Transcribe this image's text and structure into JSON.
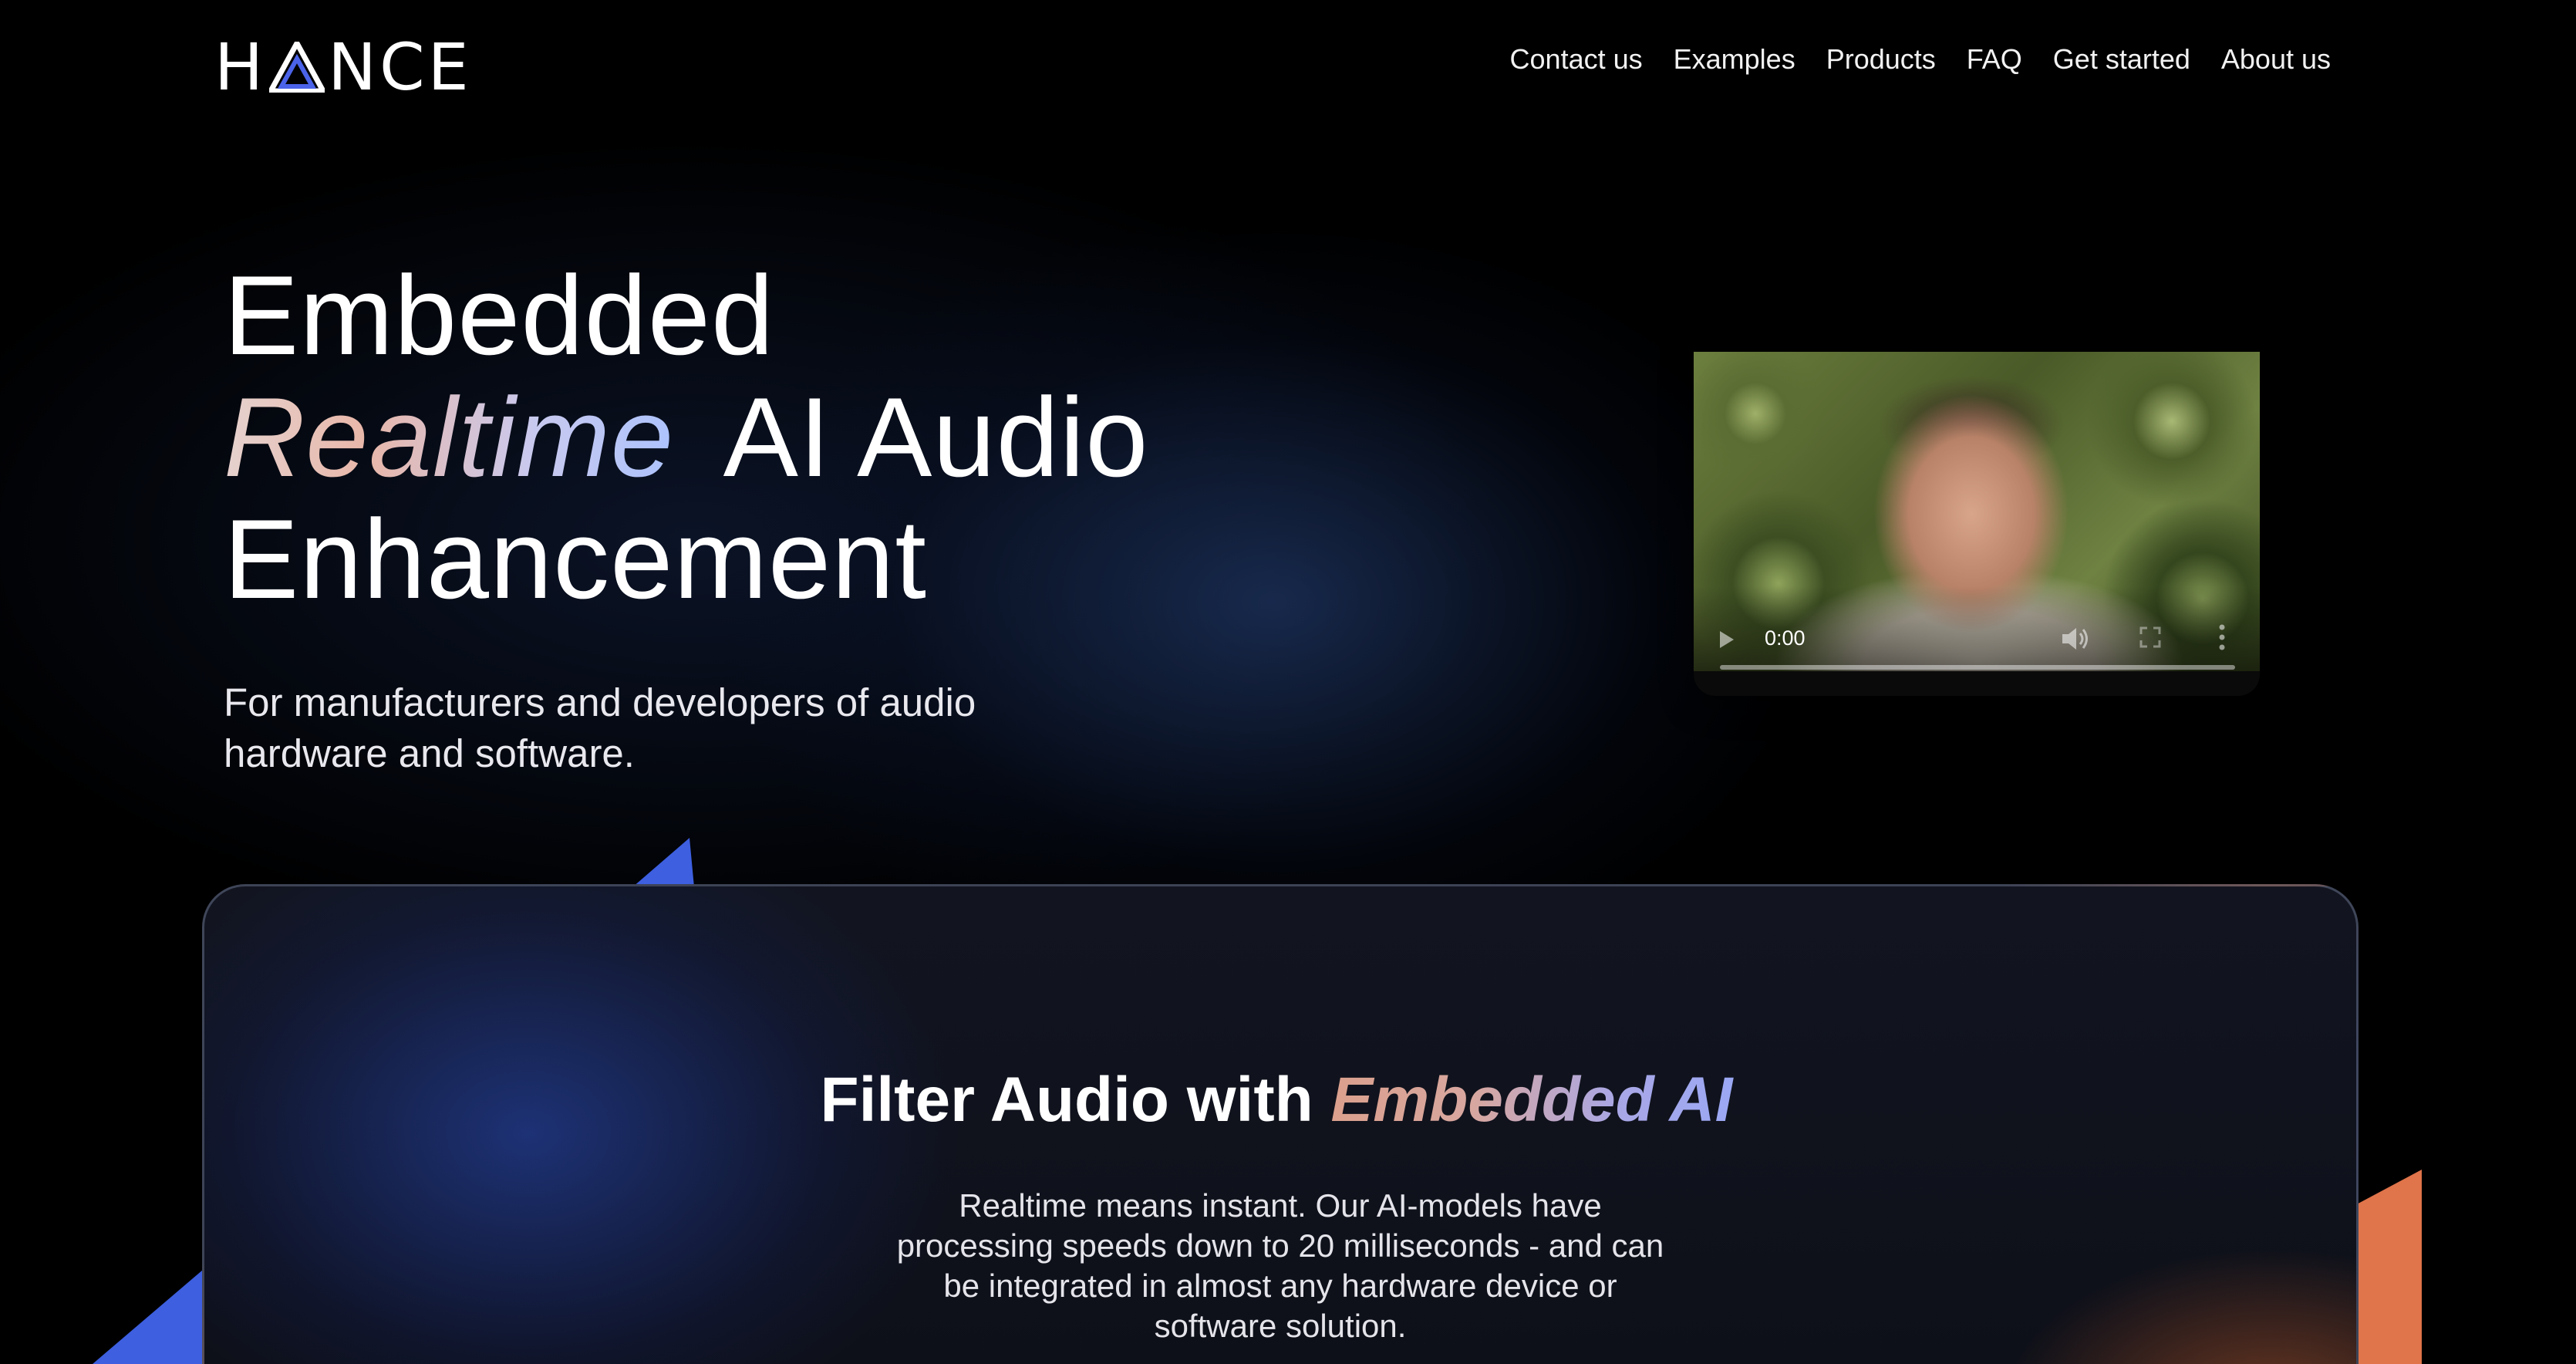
{
  "brand": {
    "name": "HANCE",
    "accent": "#4a63e8"
  },
  "nav": {
    "items": [
      "Contact us",
      "Examples",
      "Products",
      "FAQ",
      "Get started",
      "About us"
    ]
  },
  "hero": {
    "line1": "Embedded",
    "highlight": "Realtime",
    "line2_rest": "AI Audio",
    "line3": "Enhancement",
    "subtitle": "For manufacturers and developers of audio hardware and software."
  },
  "video": {
    "time": "0:00",
    "progress": 0,
    "icons": [
      "play-icon",
      "volume-icon",
      "fullscreen-icon",
      "more-icon"
    ]
  },
  "card": {
    "title_start": "Filter Audio with",
    "title_accent": "Embedded AI",
    "body": "Realtime means instant. Our AI-models have processing speeds down to 20 milliseconds - and can be integrated in almost any hardware device or software solution."
  },
  "colors": {
    "background": "#000000",
    "deco_blue": "#3d5fe0",
    "deco_orange": "#e0744a"
  }
}
